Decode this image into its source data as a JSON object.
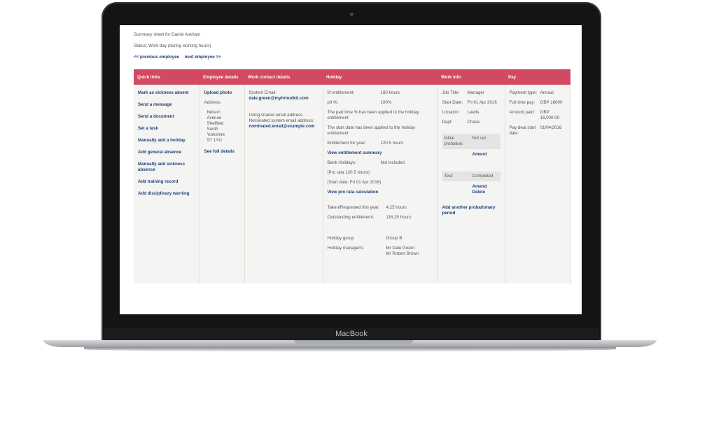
{
  "device": {
    "brand": "MacBook"
  },
  "header": {
    "title": "Summary sheet for Daniel Askham",
    "status": "Status: Work day (during working hours)",
    "prev_link": "<< previous employee",
    "next_link": "next employee >>"
  },
  "columns": {
    "quick_links": "Quick links",
    "employee_details": "Employee details",
    "work_contact": "Work contact details",
    "holiday": "Holiday",
    "work_info": "Work info",
    "pay": "Pay"
  },
  "quick_links": [
    "Mark as sickness absent",
    "Send a message",
    "Send a document",
    "Set a task",
    "Manually add a holiday",
    "Add general absence",
    "Manually add sickness absence",
    "Add training record",
    "Add disciplinary warning"
  ],
  "employee_details": {
    "upload_photo": "Upload photo",
    "address_label": "Address:",
    "address": [
      "Nelson",
      "Avenue",
      "Sheffield",
      "South",
      "Yorkshire",
      "S7 1YU"
    ],
    "see_full_details": "See full details"
  },
  "work_contact": {
    "system_email_label": "System Email:",
    "system_email": "dale.green@myhrtoolkit.com",
    "shared_note": "Using shared email address Nominated system email address:",
    "nominated_email": "nominated.email@example.com"
  },
  "holiday": {
    "ft_label": "f/t entitlement:",
    "ft_value": "160 hours",
    "pa_label": "p/t %:",
    "pa_value": "100%",
    "note1": "The part time % has been applied to the holiday entitlement",
    "note2": "The start date has been applied to the holiday entitlement",
    "year_label": "Entitlement for year:",
    "year_value": "120.5 hours",
    "view_summary": "View entitlement summary",
    "bank_label": "Bank Holidays:",
    "bank_value": "Not included",
    "pro_rata": "(Pro rata 120.5 hours)",
    "start_date": "(Start date: Fri 01 Apr 2016)",
    "view_pro_rata": "View pro rata calculation",
    "taken_label": "Taken/Requested this year:",
    "taken_value": "4.25 hours",
    "outstanding_label": "Outstanding entitlement:",
    "outstanding_value": "116.25 hours",
    "group_label": "Holiday group",
    "group_value": "Group B",
    "manager_label": "Holiday manager/s",
    "manager_1": "Mr Dale Green",
    "manager_2": "Mr Robert Brown"
  },
  "work_info": {
    "job_title_label": "Job Title:",
    "job_title": "Manager",
    "start_label": "Start Date:",
    "start_value": "Fri 01 Apr 2016",
    "location_label": "Location:",
    "location": "Leeds",
    "dept_label": "Dept:",
    "dept": "Chase",
    "probation_label": "Initial probation:",
    "probation_value": "Not set",
    "amend": "Amend",
    "test_label": "Test:",
    "test_value": "Completed",
    "amend2": "Amend",
    "delete": "Delete",
    "add_probation": "Add another probationary period"
  },
  "pay": {
    "payment_type_label": "Payment type:",
    "payment_type": "Annual",
    "full_time_label": "Full time pay:",
    "full_time": "GBP 16000",
    "amount_label": "Amount paid:",
    "amount": "GBP 16,000.00",
    "pay_deal_label": "Pay deal start date:",
    "pay_deal": "01/04/2016"
  },
  "colors": {
    "header_bg": "#d24a61",
    "link": "#1f3f7a",
    "cell_bg": "#f4f4f2"
  }
}
